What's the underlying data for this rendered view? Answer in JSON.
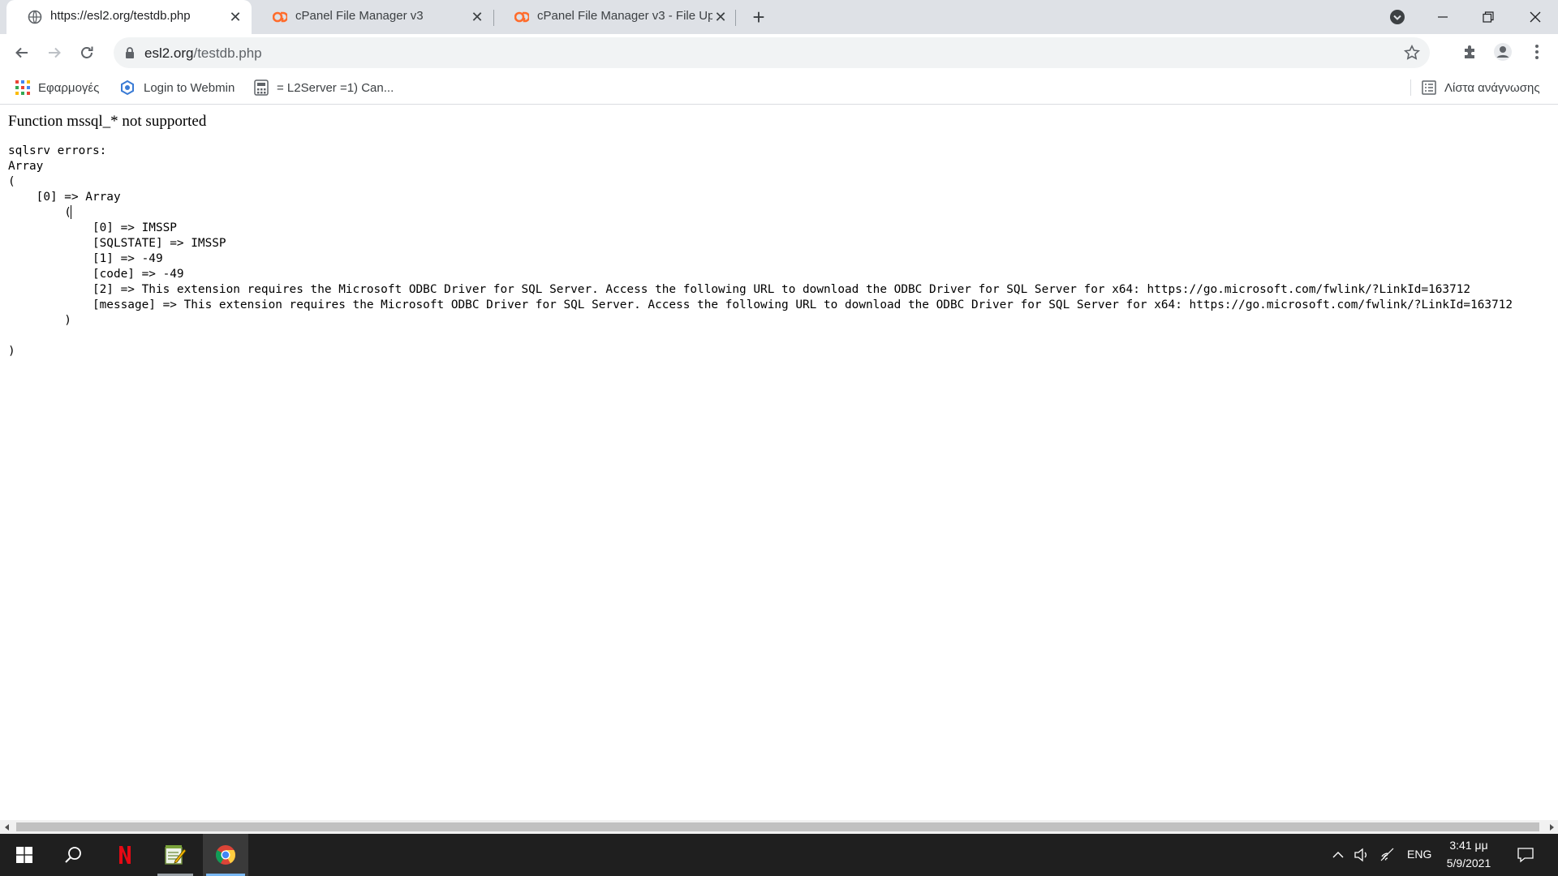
{
  "browser": {
    "tabs": [
      {
        "title": "https://esl2.org/testdb.php",
        "active": true,
        "favicon": "globe-icon"
      },
      {
        "title": "cPanel File Manager v3",
        "active": false,
        "favicon": "cpanel-icon"
      },
      {
        "title": "cPanel File Manager v3 - File Upl",
        "active": false,
        "favicon": "cpanel-icon"
      }
    ],
    "close_glyph": "✕",
    "new_tab_glyph": "+",
    "address": {
      "domain": "esl2.org",
      "path": "/testdb.php"
    },
    "bookmarks": [
      {
        "label": "Εφαρμογές",
        "icon": "apps-grid-icon"
      },
      {
        "label": "Login to Webmin",
        "icon": "webmin-icon"
      },
      {
        "label": "= L2Server =1) Can...",
        "icon": "calculator-icon"
      }
    ],
    "reading_list_label": "Λίστα ανάγνωσης"
  },
  "page": {
    "headline": "Function mssql_* not supported",
    "dump_lines": [
      "sqlsrv errors:",
      "Array",
      "(",
      "    [0] => Array",
      "        (",
      "            [0] => IMSSP",
      "            [SQLSTATE] => IMSSP",
      "            [1] => -49",
      "            [code] => -49",
      "            [2] => This extension requires the Microsoft ODBC Driver for SQL Server. Access the following URL to download the ODBC Driver for SQL Server for x64: https://go.microsoft.com/fwlink/?LinkId=163712",
      "            [message] => This extension requires the Microsoft ODBC Driver for SQL Server. Access the following URL to download the ODBC Driver for SQL Server for x64: https://go.microsoft.com/fwlink/?LinkId=163712",
      "        )",
      "",
      ")"
    ]
  },
  "taskbar": {
    "apps": [
      {
        "name": "netflix",
        "icon": "netflix-icon"
      },
      {
        "name": "notepad",
        "icon": "notepad-icon"
      },
      {
        "name": "chrome",
        "icon": "chrome-icon",
        "active": true
      }
    ],
    "language": "ENG",
    "time": "3:41 μμ",
    "date": "5/9/2021"
  },
  "colors": {
    "tabstrip": "#dee1e6",
    "omnibox": "#f1f3f4",
    "taskbar": "#1f1f1f",
    "cpanel_orange": "#ff6c2c",
    "netflix_red": "#e50914",
    "active_app_indicator": "#79b8f3"
  }
}
